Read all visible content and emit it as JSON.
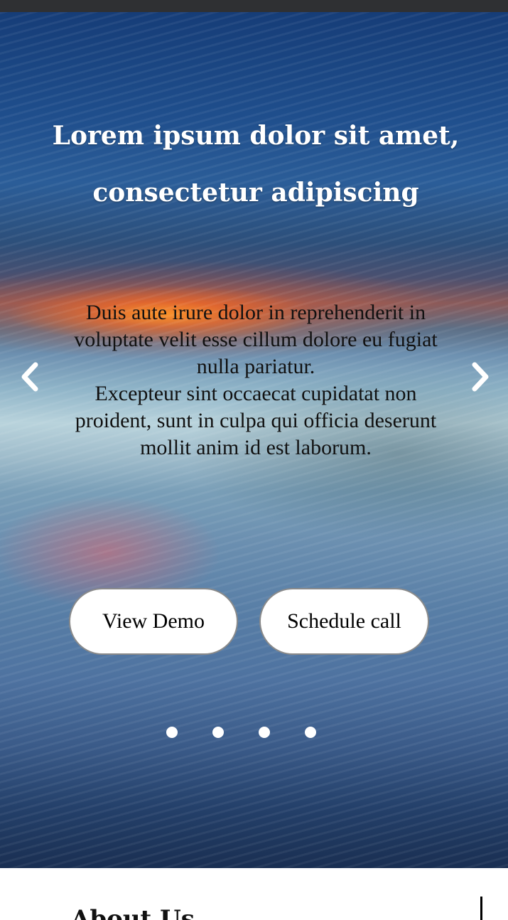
{
  "hero": {
    "title_line1": "Lorem ipsum dolor sit amet,",
    "title_line2": "consectetur adipiscing",
    "body_paragraph1": "Duis aute irure dolor in reprehenderit in voluptate velit esse cillum dolore eu fugiat nulla pariatur.",
    "body_paragraph2": "Excepteur sint occaecat cupidatat non proident, sunt in culpa qui officia deserunt mollit anim id est laborum.",
    "view_demo_label": "View Demo",
    "schedule_call_label": "Schedule call",
    "slide_count": 4
  },
  "about": {
    "heading": "About Us"
  },
  "icons": {
    "prev": "chevron-left-icon",
    "next": "chevron-right-icon"
  },
  "colors": {
    "topbar": "#2f3033",
    "button_bg": "#ffffff",
    "button_border": "#8a8a8a",
    "title_text": "#ffffff",
    "body_text": "#111111"
  }
}
